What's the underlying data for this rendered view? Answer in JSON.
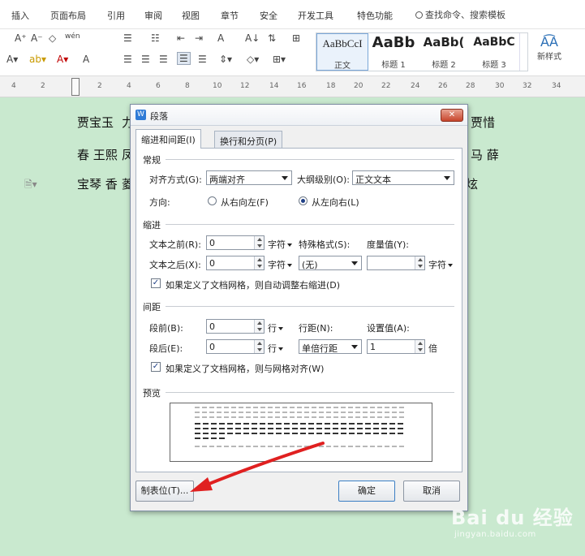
{
  "menu": {
    "tabs": [
      "插入",
      "页面布局",
      "引用",
      "审阅",
      "视图",
      "章节",
      "安全",
      "开发工具",
      "特色功能"
    ],
    "search": "查找命令、搜索模板"
  },
  "ribbon": {
    "font_glyphs": [
      "A⁺",
      "A⁻",
      "◇",
      "wén"
    ],
    "para_glyphs": [
      "☰",
      "☷",
      "⇤",
      "⇥",
      "A",
      "A↓",
      "⇅",
      "⊞"
    ],
    "styles": [
      {
        "preview": "AaBbCcI",
        "caption": "正文",
        "selected": true
      },
      {
        "preview": "AaBb",
        "caption": "标题 1",
        "selected": false
      },
      {
        "preview": "AaBb(",
        "caption": "标题 2",
        "selected": false
      },
      {
        "preview": "AaBbC",
        "caption": "标题 3",
        "selected": false
      }
    ],
    "new_style_label": "新样式"
  },
  "ruler": {
    "numbers": [
      "4",
      "2",
      "2",
      "4",
      "6",
      "8",
      "10",
      "12",
      "14",
      "16",
      "18",
      "20",
      "22",
      "24",
      "26",
      "28",
      "30",
      "32",
      "34"
    ]
  },
  "document": {
    "line1_left": "贾宝玉",
    "line1_frag": "力",
    "line1_right": "贾惜",
    "line2_left": "春 王熙",
    "line2_frag": "凤",
    "line2_right": "马 薛",
    "line3_left": "宝琴 香",
    "line3_frag": "菱",
    "line3_right": "炫"
  },
  "dialog": {
    "title": "段落",
    "close_label": "✕",
    "tabs": [
      {
        "label": "缩进和间距(I)",
        "active": true
      },
      {
        "label": "换行和分页(P)",
        "active": false
      }
    ],
    "general": {
      "section": "常规",
      "align_label": "对齐方式(G):",
      "align_value": "两端对齐",
      "outline_label": "大纲级别(O):",
      "outline_value": "正文文本",
      "direction_label": "方向:",
      "rtl_label": "从右向左(F)",
      "ltr_label": "从左向右(L)",
      "direction_selected": "ltr"
    },
    "indent": {
      "section": "缩进",
      "before_label": "文本之前(R):",
      "before_value": "0",
      "before_unit": "字符",
      "after_label": "文本之后(X):",
      "after_value": "0",
      "after_unit": "字符",
      "special_label": "特殊格式(S):",
      "special_value": "(无)",
      "measure_label": "度量值(Y):",
      "measure_value": "",
      "measure_unit": "字符",
      "auto_adjust_label": "如果定义了文档网格，则自动调整右缩进(D)",
      "auto_adjust_checked": true
    },
    "spacing": {
      "section": "间距",
      "before_label": "段前(B):",
      "before_value": "0",
      "before_unit": "行",
      "after_label": "段后(E):",
      "after_value": "0",
      "after_unit": "行",
      "line_label": "行距(N):",
      "line_value": "单倍行距",
      "setting_label": "设置值(A):",
      "setting_value": "1",
      "setting_unit": "倍",
      "snap_label": "如果定义了文档网格，则与网格对齐(W)",
      "snap_checked": true
    },
    "preview": {
      "section": "预览"
    },
    "buttons": {
      "tabs": "制表位(T)...",
      "ok": "确定",
      "cancel": "取消"
    }
  },
  "watermark": {
    "brand": "Bai du 经验",
    "url": "jingyan.baidu.com"
  },
  "colors": {
    "doc_bg": "#c9e9cf",
    "accent": "#2f7bd6",
    "arrow": "#e02020"
  }
}
